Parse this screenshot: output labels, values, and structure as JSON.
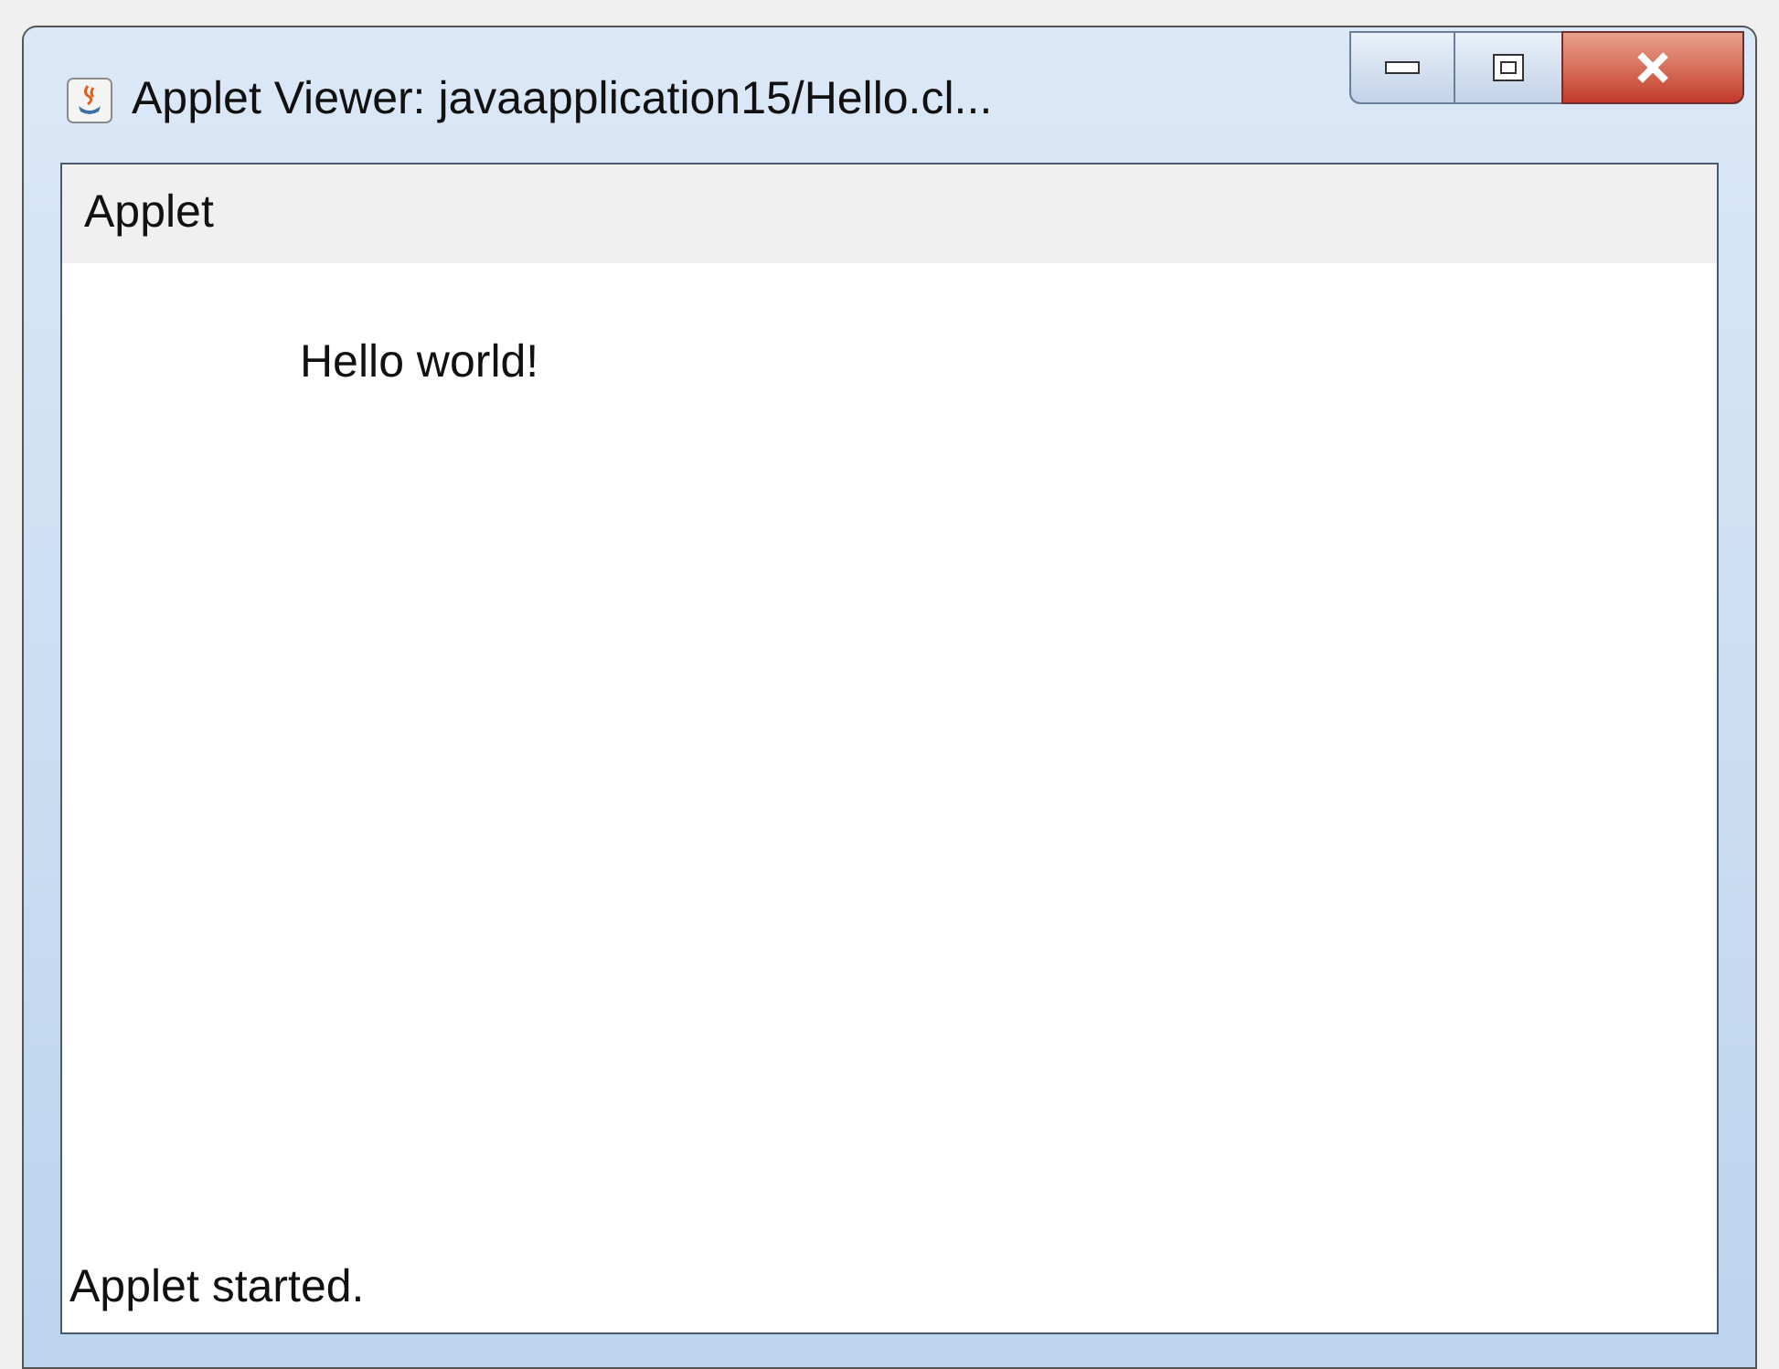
{
  "window": {
    "title": "Applet Viewer: javaapplication15/Hello.cl..."
  },
  "menu_bar": {
    "items": [
      "Applet"
    ]
  },
  "applet": {
    "text": "Hello world!"
  },
  "status_bar": {
    "text": "Applet started."
  }
}
